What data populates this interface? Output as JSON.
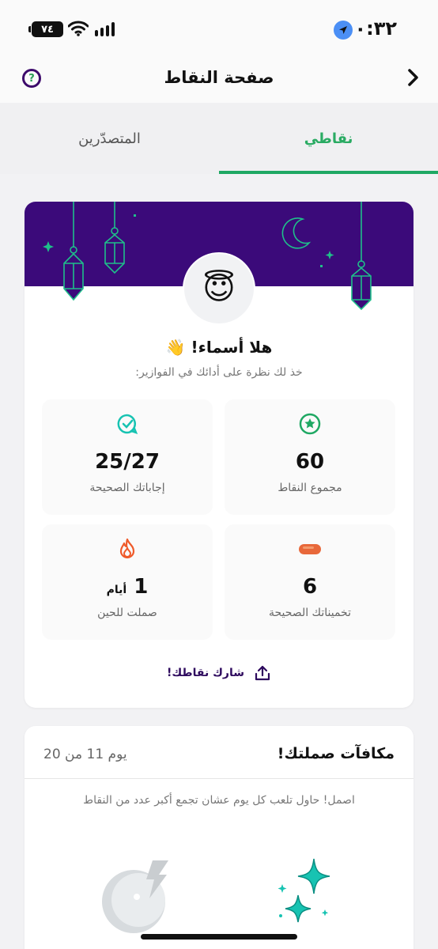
{
  "status_bar": {
    "time": "١٠:٣٢",
    "battery": "٧٤",
    "location_icon": "location-arrow-icon",
    "wifi_icon": "wifi-icon",
    "signal_icon": "signal-bars-icon"
  },
  "header": {
    "title": "صفحة النقاط",
    "back_icon": "chevron-right-icon",
    "help_icon": "question-circle-icon",
    "help_glyph": "?"
  },
  "tabs": [
    {
      "label": "نقاطي",
      "active": true
    },
    {
      "label": "المتصدّرين",
      "active": false
    }
  ],
  "profile": {
    "avatar_emoji": "😇",
    "greeting": "هلا أسماء! 👋",
    "subtitle": "خذ لك نظرة على أدائك في الفوازير:"
  },
  "stats": [
    {
      "id": "total_points",
      "icon": "star-circle-icon",
      "value": "60",
      "unit": "",
      "label": "مجموع النقاط"
    },
    {
      "id": "correct_answers",
      "icon": "chat-check-icon",
      "value": "25/27",
      "unit": "",
      "label": "إجاباتك الصحيحة"
    },
    {
      "id": "correct_guesses",
      "icon": "date-fruit-icon",
      "value": "6",
      "unit": "",
      "label": "تخميناتك الصحيحة"
    },
    {
      "id": "streak",
      "icon": "flame-icon",
      "value": "1",
      "unit": "أيام",
      "label": "صملت للحين"
    }
  ],
  "share": {
    "label": "شارك نقاطك!",
    "icon": "share-icon"
  },
  "rewards": {
    "title": "مكافآت صملتك!",
    "day_progress": "يوم 11 من 20",
    "description": "اصمل! حاول تلعب كل يوم عشان تجمع أكبر عدد من النقاط"
  },
  "colors": {
    "brand_purple": "#3b0a7a",
    "accent_green": "#1fa863",
    "teal": "#17c3b2",
    "flame": "#ef5a2a"
  }
}
